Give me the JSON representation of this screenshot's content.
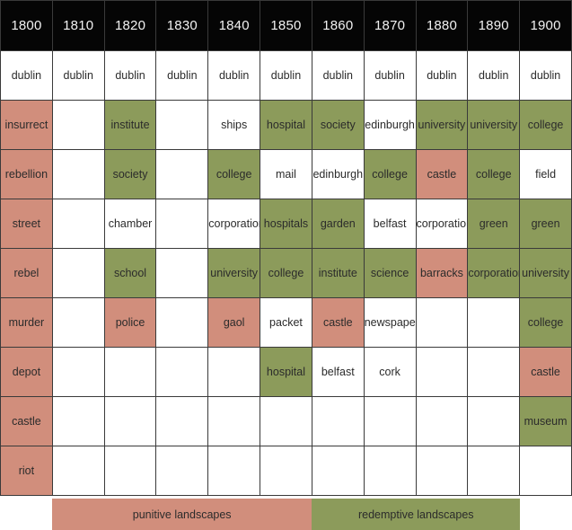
{
  "chart_data": {
    "type": "table",
    "title": "",
    "xlabel": "",
    "ylabel": "",
    "categories": [
      "1800",
      "1810",
      "1820",
      "1830",
      "1840",
      "1850",
      "1860",
      "1870",
      "1880",
      "1890",
      "1900"
    ],
    "legend_position": "bottom",
    "legend": [
      {
        "label": "punitive landscapes",
        "color": "#d18e7c",
        "key": "punitive"
      },
      {
        "label": "redemptive landscapes",
        "color": "#8c9b5b",
        "key": "redemptive"
      }
    ],
    "colors": {
      "punitive": "#d18e7c",
      "redemptive": "#8c9b5b",
      "neutral": "#ffffff",
      "header_background": "#050505",
      "header_text": "#f2f2f2",
      "grid_line": "#3a3a3a"
    },
    "rows": [
      [
        {
          "text": "dublin",
          "class": "neutral"
        },
        {
          "text": "dublin",
          "class": "neutral"
        },
        {
          "text": "dublin",
          "class": "neutral"
        },
        {
          "text": "dublin",
          "class": "neutral"
        },
        {
          "text": "dublin",
          "class": "neutral"
        },
        {
          "text": "dublin",
          "class": "neutral"
        },
        {
          "text": "dublin",
          "class": "neutral"
        },
        {
          "text": "dublin",
          "class": "neutral"
        },
        {
          "text": "dublin",
          "class": "neutral"
        },
        {
          "text": "dublin",
          "class": "neutral"
        },
        {
          "text": "dublin",
          "class": "neutral"
        }
      ],
      [
        {
          "text": "insurrect",
          "class": "punitive"
        },
        {
          "text": "",
          "class": "empty"
        },
        {
          "text": "institute",
          "class": "redemptive"
        },
        {
          "text": "",
          "class": "empty"
        },
        {
          "text": "ships",
          "class": "neutral"
        },
        {
          "text": "hospital",
          "class": "redemptive"
        },
        {
          "text": "society",
          "class": "redemptive"
        },
        {
          "text": "edinburgh",
          "class": "neutral"
        },
        {
          "text": "university",
          "class": "redemptive"
        },
        {
          "text": "university",
          "class": "redemptive"
        },
        {
          "text": "college",
          "class": "redemptive"
        }
      ],
      [
        {
          "text": "rebellion",
          "class": "punitive"
        },
        {
          "text": "",
          "class": "empty"
        },
        {
          "text": "society",
          "class": "redemptive"
        },
        {
          "text": "",
          "class": "empty"
        },
        {
          "text": "college",
          "class": "redemptive"
        },
        {
          "text": "mail",
          "class": "neutral"
        },
        {
          "text": "edinburgh",
          "class": "neutral"
        },
        {
          "text": "college",
          "class": "redemptive"
        },
        {
          "text": "castle",
          "class": "punitive"
        },
        {
          "text": "college",
          "class": "redemptive"
        },
        {
          "text": "field",
          "class": "neutral"
        }
      ],
      [
        {
          "text": "street",
          "class": "punitive"
        },
        {
          "text": "",
          "class": "empty"
        },
        {
          "text": "chamber",
          "class": "neutral"
        },
        {
          "text": "",
          "class": "empty"
        },
        {
          "text": "corporation",
          "class": "neutral"
        },
        {
          "text": "hospitals",
          "class": "redemptive"
        },
        {
          "text": "garden",
          "class": "redemptive"
        },
        {
          "text": "belfast",
          "class": "neutral"
        },
        {
          "text": "corporation",
          "class": "neutral"
        },
        {
          "text": "green",
          "class": "redemptive"
        },
        {
          "text": "green",
          "class": "redemptive"
        }
      ],
      [
        {
          "text": "rebel",
          "class": "punitive"
        },
        {
          "text": "",
          "class": "empty"
        },
        {
          "text": "school",
          "class": "redemptive"
        },
        {
          "text": "",
          "class": "empty"
        },
        {
          "text": "university",
          "class": "redemptive"
        },
        {
          "text": "college",
          "class": "redemptive"
        },
        {
          "text": "institute",
          "class": "redemptive"
        },
        {
          "text": "science",
          "class": "redemptive"
        },
        {
          "text": "barracks",
          "class": "punitive"
        },
        {
          "text": "corporation",
          "class": "redemptive"
        },
        {
          "text": "university",
          "class": "redemptive"
        }
      ],
      [
        {
          "text": "murder",
          "class": "punitive"
        },
        {
          "text": "",
          "class": "empty"
        },
        {
          "text": "police",
          "class": "punitive"
        },
        {
          "text": "",
          "class": "empty"
        },
        {
          "text": "gaol",
          "class": "punitive"
        },
        {
          "text": "packet",
          "class": "neutral"
        },
        {
          "text": "castle",
          "class": "punitive"
        },
        {
          "text": "newspaper",
          "class": "neutral"
        },
        {
          "text": "",
          "class": "empty"
        },
        {
          "text": "",
          "class": "empty"
        },
        {
          "text": "college",
          "class": "redemptive"
        }
      ],
      [
        {
          "text": "depot",
          "class": "punitive"
        },
        {
          "text": "",
          "class": "empty"
        },
        {
          "text": "",
          "class": "empty"
        },
        {
          "text": "",
          "class": "empty"
        },
        {
          "text": "",
          "class": "empty"
        },
        {
          "text": "hospital",
          "class": "redemptive"
        },
        {
          "text": "belfast",
          "class": "neutral"
        },
        {
          "text": "cork",
          "class": "neutral"
        },
        {
          "text": "",
          "class": "empty"
        },
        {
          "text": "",
          "class": "empty"
        },
        {
          "text": "castle",
          "class": "punitive"
        }
      ],
      [
        {
          "text": "castle",
          "class": "punitive"
        },
        {
          "text": "",
          "class": "empty"
        },
        {
          "text": "",
          "class": "empty"
        },
        {
          "text": "",
          "class": "empty"
        },
        {
          "text": "",
          "class": "empty"
        },
        {
          "text": "",
          "class": "empty"
        },
        {
          "text": "",
          "class": "empty"
        },
        {
          "text": "",
          "class": "empty"
        },
        {
          "text": "",
          "class": "empty"
        },
        {
          "text": "",
          "class": "empty"
        },
        {
          "text": "museum",
          "class": "redemptive"
        }
      ],
      [
        {
          "text": "riot",
          "class": "punitive"
        },
        {
          "text": "",
          "class": "empty"
        },
        {
          "text": "",
          "class": "empty"
        },
        {
          "text": "",
          "class": "empty"
        },
        {
          "text": "",
          "class": "empty"
        },
        {
          "text": "",
          "class": "empty"
        },
        {
          "text": "",
          "class": "empty"
        },
        {
          "text": "",
          "class": "empty"
        },
        {
          "text": "",
          "class": "empty"
        },
        {
          "text": "",
          "class": "empty"
        },
        {
          "text": "",
          "class": "empty"
        }
      ]
    ]
  }
}
